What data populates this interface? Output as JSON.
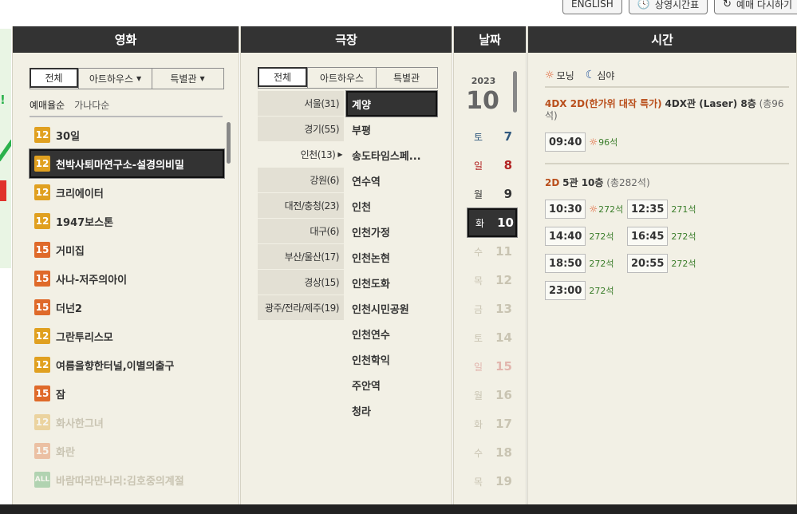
{
  "top_buttons": [
    {
      "label": "ENGLISH",
      "icon": ""
    },
    {
      "label": "상영시간표",
      "icon": "clock-icon"
    },
    {
      "label": "예매 다시하기",
      "icon": "refresh-icon"
    }
  ],
  "movie": {
    "header": "영화",
    "tabs": [
      {
        "label": "전체"
      },
      {
        "label": "아트하우스"
      },
      {
        "label": "특별관"
      }
    ],
    "sort": [
      "예매율순",
      "가나다순"
    ],
    "items": [
      {
        "rating": "12",
        "title": "30일"
      },
      {
        "rating": "12",
        "title": "천박사퇴마연구소-설경의비밀"
      },
      {
        "rating": "12",
        "title": "크리에이터"
      },
      {
        "rating": "12",
        "title": "1947보스톤"
      },
      {
        "rating": "15",
        "title": "거미집"
      },
      {
        "rating": "15",
        "title": "사나-저주의아이"
      },
      {
        "rating": "15",
        "title": "더넌2"
      },
      {
        "rating": "12",
        "title": "그란투리스모"
      },
      {
        "rating": "12",
        "title": "여름을향한터널,이별의출구"
      },
      {
        "rating": "15",
        "title": "잠"
      },
      {
        "rating": "12",
        "title": "화사한그녀"
      },
      {
        "rating": "15",
        "title": "화란"
      },
      {
        "rating": "ALL",
        "title": "바람따라만나리:김호중의계절"
      }
    ]
  },
  "theater": {
    "header": "극장",
    "tabs": [
      {
        "label": "전체"
      },
      {
        "label": "아트하우스"
      },
      {
        "label": "특별관"
      }
    ],
    "regions": [
      "서울(31)",
      "경기(55)",
      "인천(13)",
      "강원(6)",
      "대전/충청(23)",
      "대구(6)",
      "부산/울산(17)",
      "경상(15)",
      "광주/전라/제주(19)"
    ],
    "theaters": [
      "계양",
      "부평",
      "송도타임스페...",
      "연수역",
      "인천",
      "인천가정",
      "인천논현",
      "인천도화",
      "인천시민공원",
      "인천연수",
      "인천학익",
      "주안역",
      "청라"
    ]
  },
  "date": {
    "header": "날짜",
    "year": "2023",
    "month": "10",
    "days": [
      {
        "wd": "토",
        "day": "7"
      },
      {
        "wd": "일",
        "day": "8"
      },
      {
        "wd": "월",
        "day": "9"
      },
      {
        "wd": "화",
        "day": "10"
      },
      {
        "wd": "수",
        "day": "11"
      },
      {
        "wd": "목",
        "day": "12"
      },
      {
        "wd": "금",
        "day": "13"
      },
      {
        "wd": "토",
        "day": "14"
      },
      {
        "wd": "일",
        "day": "15"
      },
      {
        "wd": "월",
        "day": "16"
      },
      {
        "wd": "화",
        "day": "17"
      },
      {
        "wd": "수",
        "day": "18"
      },
      {
        "wd": "목",
        "day": "19"
      }
    ]
  },
  "time": {
    "header": "시간",
    "legend_morning": "모닝",
    "legend_night": "심야",
    "blocks": [
      {
        "format": "4DX 2D(한가위 대작 특가)",
        "hall": "4DX관 (Laser) 8층",
        "total": "(총96석)",
        "showtimes": [
          {
            "time": "09:40",
            "seats": "96석",
            "morning": true
          }
        ]
      },
      {
        "format": "2D",
        "hall": "5관 10층",
        "total": "(총282석)",
        "showtimes": [
          {
            "time": "10:30",
            "seats": "272석",
            "morning": true
          },
          {
            "time": "12:35",
            "seats": "271석",
            "morning": false
          },
          {
            "time": "14:40",
            "seats": "272석",
            "morning": false
          },
          {
            "time": "16:45",
            "seats": "272석",
            "morning": false
          },
          {
            "time": "18:50",
            "seats": "272석",
            "morning": false
          },
          {
            "time": "20:55",
            "seats": "272석",
            "morning": false
          },
          {
            "time": "23:00",
            "seats": "272석",
            "morning": false
          }
        ]
      }
    ]
  },
  "colors": {
    "header_bg": "#333333",
    "panel_bg": "#f2f0e5",
    "format_orange": "#b94e1b",
    "seats_green": "#3a7d2a",
    "rating12": "#e0a020",
    "rating15": "#df6a2a",
    "ratingAll": "#3aa052"
  }
}
